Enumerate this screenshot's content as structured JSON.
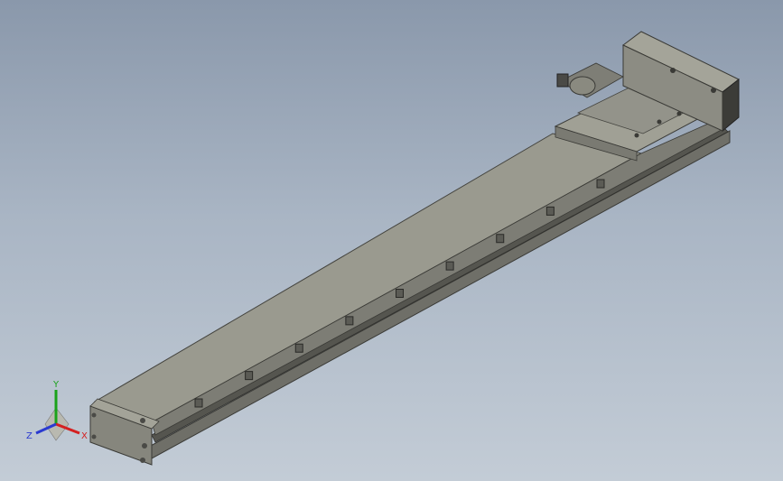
{
  "viewport": {
    "background_top": "#8a98ab",
    "background_bottom": "#c3ccd6"
  },
  "triad": {
    "x_label": "X",
    "y_label": "Y",
    "z_label": "Z",
    "x_color": "#d42020",
    "y_color": "#1aa21a",
    "z_color": "#2a3ad0"
  },
  "model": {
    "icon": "linear-actuator-model",
    "body_color": "#8a8a80",
    "top_color": "#9a9a8f",
    "dark_color": "#4a4a46"
  }
}
